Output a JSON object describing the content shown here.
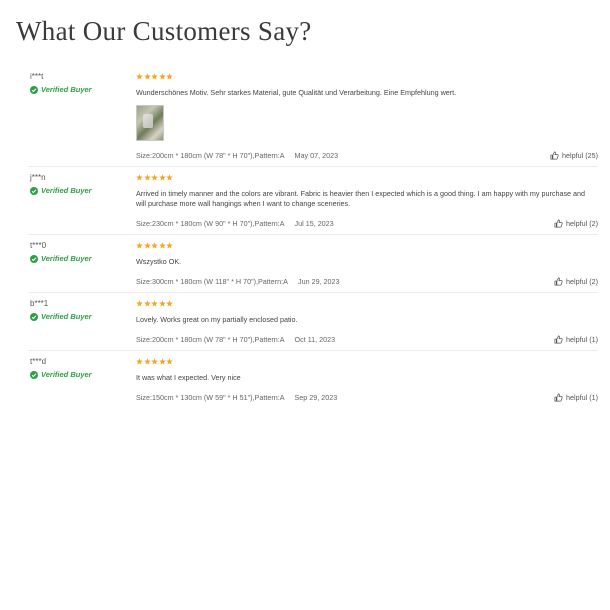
{
  "page": {
    "title": "What Our Customers Say?"
  },
  "verified_label": "Verified Buyer",
  "colors": {
    "star": "#f4a72a",
    "verified": "#2e9e46"
  },
  "icons": {
    "rating": "star-icon",
    "verified": "check-circle-icon",
    "helpful": "thumbs-up-icon"
  },
  "reviews": [
    {
      "reviewer": "i***t",
      "rating": 5,
      "text": "Wunderschönes Motiv. Sehr starkes Material, gute Qualität und Verarbeitung. Eine Empfehlung wert.",
      "size": "Size:200cm * 180cm (W 78\" * H 70\"),Pattern:A",
      "date": "May 07, 2023",
      "helpful": "helpful (25)",
      "has_photo": true
    },
    {
      "reviewer": "j***n",
      "rating": 5,
      "text": "Arrived in timely manner and the colors are vibrant. Fabric is heavier then I expected which is a good thing. I am happy with my purchase and will purchase more wall hangings when I want to change sceneries.",
      "size": "Size:230cm * 180cm (W 90\" * H 70\"),Pattern:A",
      "date": "Jul 15, 2023",
      "helpful": "helpful (2)",
      "has_photo": false
    },
    {
      "reviewer": "t***0",
      "rating": 5,
      "text": "Wszystko OK.",
      "size": "Size:300cm * 180cm (W 118\" * H 70\"),Pattern:A",
      "date": "Jun 29, 2023",
      "helpful": "helpful (2)",
      "has_photo": false
    },
    {
      "reviewer": "b***1",
      "rating": 5,
      "text": "Lovely. Works great on my partially enclosed patio.",
      "size": "Size:200cm * 180cm (W 78\" * H 70\"),Pattern:A",
      "date": "Oct 11, 2023",
      "helpful": "helpful (1)",
      "has_photo": false
    },
    {
      "reviewer": "t***d",
      "rating": 5,
      "text": "It was what I expected. Very nice",
      "size": "Size:150cm * 130cm (W 59\" * H 51\"),Pattern:A",
      "date": "Sep 29, 2023",
      "helpful": "helpful (1)",
      "has_photo": false
    }
  ]
}
